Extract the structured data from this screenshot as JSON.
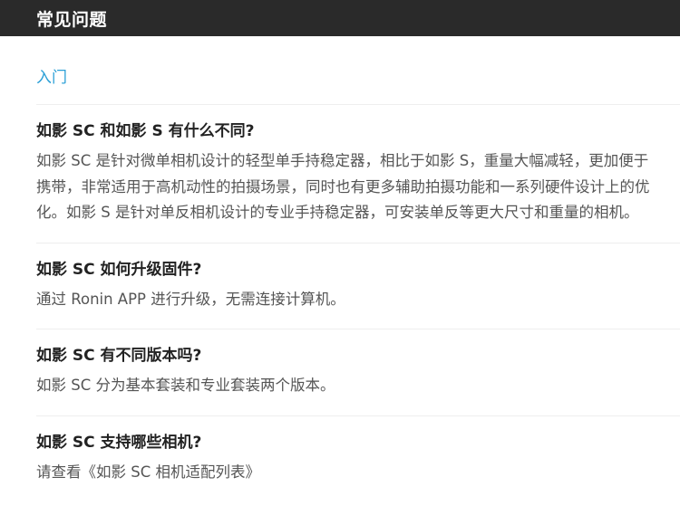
{
  "header": {
    "title": "常见问题"
  },
  "category": {
    "label": "入门",
    "color": "#2a9fd6"
  },
  "faqs": [
    {
      "question": "如影 SC 和如影 S 有什么不同?",
      "answer": "如影 SC 是针对微单相机设计的轻型单手持稳定器，相比于如影 S，重量大幅减轻，更加便于携带，非常适用于高机动性的拍摄场景，同时也有更多辅助拍摄功能和一系列硬件设计上的优化。如影 S 是针对单反相机设计的专业手持稳定器，可安装单反等更大尺寸和重量的相机。"
    },
    {
      "question": "如影 SC 如何升级固件?",
      "answer": "通过 Ronin APP 进行升级，无需连接计算机。"
    },
    {
      "question": "如影 SC 有不同版本吗?",
      "answer": "如影 SC 分为基本套装和专业套装两个版本。"
    },
    {
      "question": "如影 SC 支持哪些相机?",
      "answer": "请查看《如影 SC 相机适配列表》"
    }
  ]
}
